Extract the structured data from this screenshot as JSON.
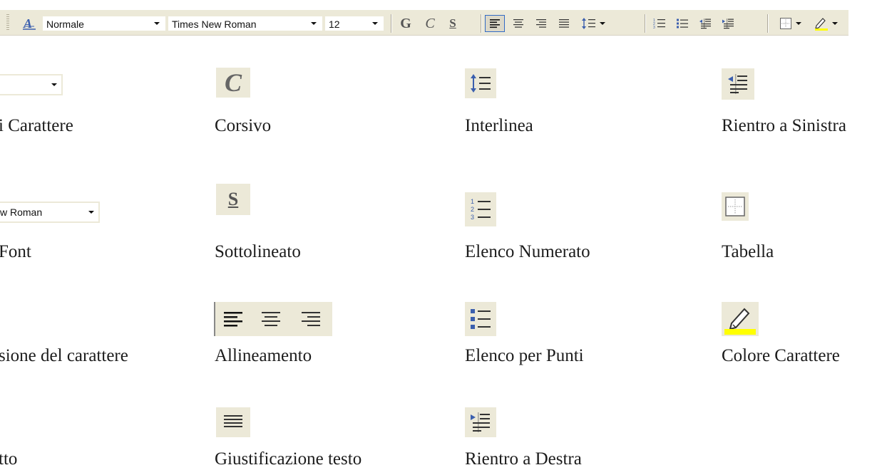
{
  "toolbar": {
    "style_value": "Normale",
    "font_value": "Times New Roman",
    "size_value": "12",
    "bold_glyph": "G",
    "italic_glyph": "C",
    "underline_glyph": "S"
  },
  "legend": {
    "col1": {
      "font_sample": "w Roman",
      "labels": [
        "i Carattere",
        " Font",
        "sione del carattere",
        "tto"
      ]
    },
    "col2": {
      "italic_glyph": "C",
      "underline_glyph": "S",
      "labels": [
        "Corsivo",
        "Sottolineato",
        "Allineamento",
        "Giustificazione testo"
      ]
    },
    "col3": {
      "labels": [
        "Interlinea",
        "Elenco Numerato",
        "Elenco per Punti",
        "Rientro a Destra"
      ]
    },
    "col4": {
      "labels": [
        "Rientro a Sinistra",
        "Tabella",
        "Colore Carattere"
      ]
    }
  },
  "colors": {
    "toolbar_bg": "#ece9d8",
    "icon_blue": "#3b5fae",
    "highlight_yellow": "#ffff00",
    "selected_border": "#316ac5"
  },
  "icons": {
    "style": "style-a-icon",
    "bold": "bold-g-icon",
    "italic": "italic-c-icon",
    "underline": "underline-s-icon",
    "align_left": "align-left-icon",
    "align_center": "align-center-icon",
    "align_right": "align-right-icon",
    "justify": "justify-icon",
    "line_spacing": "line-spacing-icon",
    "numbered_list": "numbered-list-icon",
    "bullet_list": "bullet-list-icon",
    "outdent": "outdent-icon",
    "indent": "indent-icon",
    "table": "table-icon",
    "highlight": "highlight-pen-icon"
  }
}
